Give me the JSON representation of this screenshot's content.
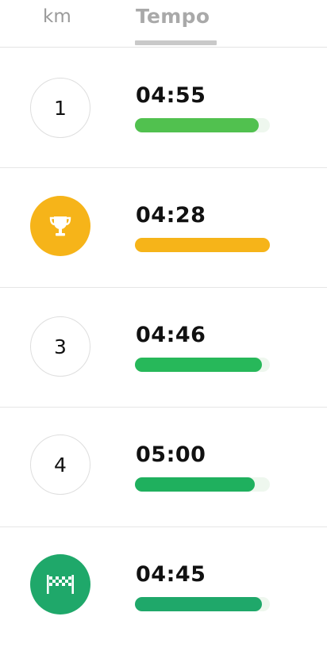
{
  "header": {
    "tabs": [
      {
        "label": "km",
        "active": false
      },
      {
        "label": "Tempo",
        "active": true
      }
    ]
  },
  "splits": [
    {
      "badge": "1",
      "badge_type": "number",
      "time": "04:55",
      "bar_fraction": 0.92,
      "bar_color": "#51c14f"
    },
    {
      "badge": "trophy",
      "badge_type": "trophy-icon",
      "time": "04:28",
      "bar_fraction": 1.0,
      "bar_color": "#f6b419"
    },
    {
      "badge": "3",
      "badge_type": "number",
      "time": "04:46",
      "bar_fraction": 0.94,
      "bar_color": "#27b85a"
    },
    {
      "badge": "4",
      "badge_type": "number",
      "time": "05:00",
      "bar_fraction": 0.89,
      "bar_color": "#1fb05e"
    },
    {
      "badge": "finish",
      "badge_type": "finish-flag-icon",
      "time": "04:45",
      "bar_fraction": 0.94,
      "bar_color": "#1fa86a"
    }
  ],
  "colors": {
    "gold": "#f6b419",
    "green": "#1fa86a",
    "light_green": "#51c14f"
  }
}
